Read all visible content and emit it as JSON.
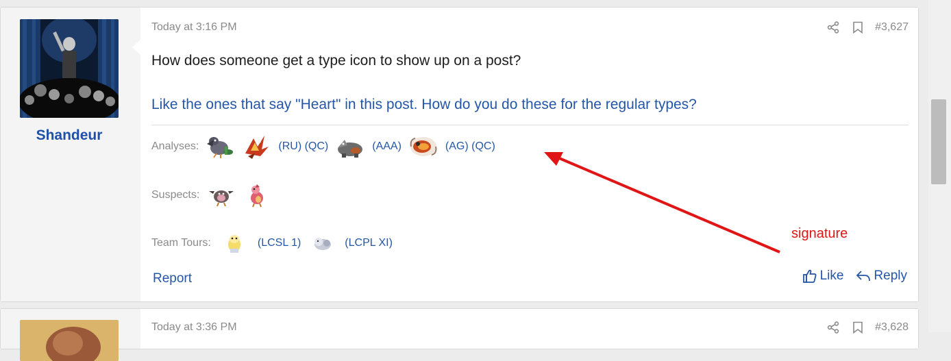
{
  "post1": {
    "username": "Shandeur",
    "timestamp": "Today at 3:16 PM",
    "post_number": "#3,627",
    "message": "How does someone get a type icon to show up on a post?",
    "message_link": "Like the ones that say \"Heart\" in this post. How do you do these for the regular types?",
    "signature": {
      "analyses_label": "Analyses:",
      "analyses_links": [
        "(RU) (QC)",
        "(AAA)",
        "(AG) (QC)"
      ],
      "suspects_label": "Suspects:",
      "team_tours_label": "Team Tours:",
      "team_tours_links": [
        "(LCSL 1)",
        "(LCPL XI)"
      ]
    },
    "report_label": "Report",
    "like_label": "Like",
    "reply_label": "Reply"
  },
  "post2": {
    "timestamp": "Today at 3:36 PM",
    "post_number": "#3,628"
  },
  "annotation": {
    "label": "signature",
    "color": "#e01515"
  },
  "colors": {
    "link": "#2456a8",
    "username": "#1f4fa8",
    "muted": "#8a8a8a"
  }
}
